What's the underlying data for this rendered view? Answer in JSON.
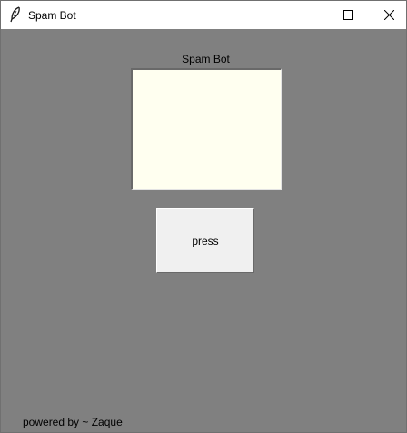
{
  "window": {
    "title": "Spam Bot",
    "app_icon": "feather-icon",
    "controls": {
      "minimize_icon": "minimize-icon",
      "maximize_icon": "maximize-icon",
      "close_icon": "close-icon"
    }
  },
  "main": {
    "heading": "Spam Bot",
    "text_area_value": "",
    "button_label": "press",
    "footer": "powered by ~ Zaque"
  },
  "colors": {
    "background": "#808080",
    "text_area": "#fffff0",
    "button": "#f0f0f0",
    "titlebar": "#ffffff"
  }
}
